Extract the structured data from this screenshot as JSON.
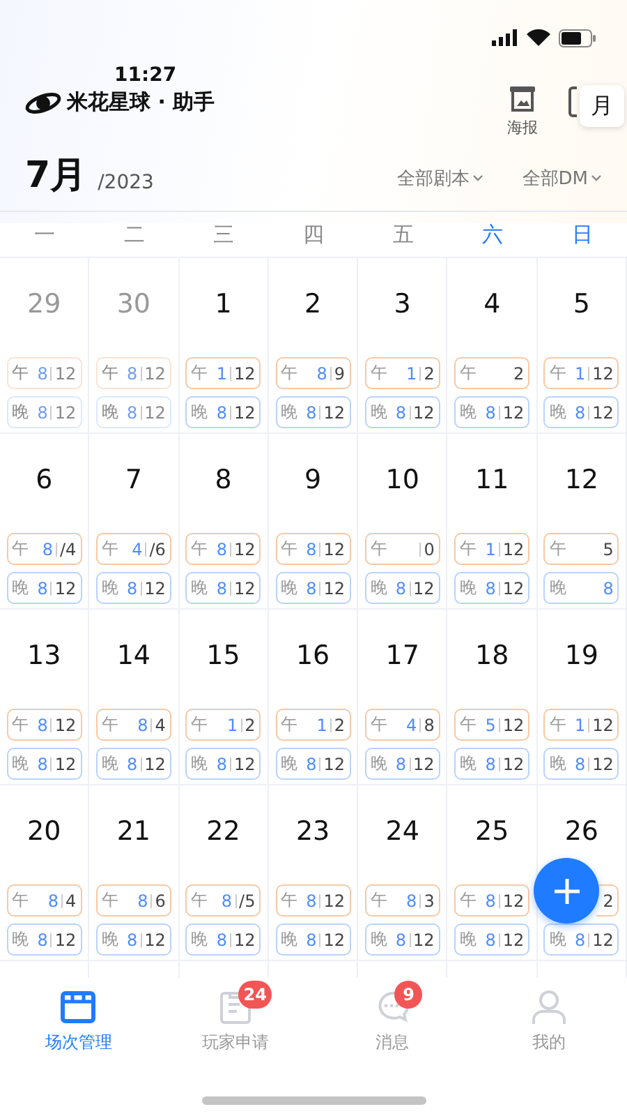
{
  "status_bar": {
    "time": "11:27"
  },
  "header": {
    "brand": "米花星球 · 助手",
    "actions": [
      {
        "label": "海报"
      }
    ],
    "view_toggle": "月"
  },
  "month_bar": {
    "month": "7月",
    "year": "/2023",
    "filters": [
      {
        "label": "全部剧本"
      },
      {
        "label": "全部DM"
      }
    ]
  },
  "weekdays": [
    {
      "label": "一",
      "weekend": false
    },
    {
      "label": "二",
      "weekend": false
    },
    {
      "label": "三",
      "weekend": false
    },
    {
      "label": "四",
      "weekend": false
    },
    {
      "label": "五",
      "weekend": false
    },
    {
      "label": "六",
      "weekend": true
    },
    {
      "label": "日",
      "weekend": true
    }
  ],
  "days": [
    {
      "day": "29",
      "faded": true,
      "slots": [
        {
          "kind": "noon",
          "label": "午",
          "booked": "8",
          "total": "12",
          "divider": true
        },
        {
          "kind": "evening",
          "label": "晚",
          "booked": "8",
          "total": "12",
          "divider": true
        }
      ]
    },
    {
      "day": "30",
      "faded": true,
      "slots": [
        {
          "kind": "noon",
          "label": "午",
          "booked": "8",
          "total": "12",
          "divider": true
        },
        {
          "kind": "evening",
          "label": "晚",
          "booked": "8",
          "total": "12",
          "divider": true
        }
      ]
    },
    {
      "day": "1",
      "faded": false,
      "slots": [
        {
          "kind": "noon",
          "label": "午",
          "booked": "1",
          "total": "12",
          "divider": true
        },
        {
          "kind": "evening",
          "label": "晚",
          "booked": "8",
          "total": "12",
          "divider": true
        }
      ]
    },
    {
      "day": "2",
      "faded": false,
      "slots": [
        {
          "kind": "noon",
          "label": "午",
          "booked": "8",
          "total": "9",
          "divider": true
        },
        {
          "kind": "evening",
          "label": "晚",
          "booked": "8",
          "total": "12",
          "divider": true
        }
      ]
    },
    {
      "day": "3",
      "faded": false,
      "slots": [
        {
          "kind": "noon",
          "label": "午",
          "booked": "1",
          "total": "2",
          "divider": true
        },
        {
          "kind": "evening",
          "label": "晚",
          "booked": "8",
          "total": "12",
          "divider": true
        }
      ]
    },
    {
      "day": "4",
      "faded": false,
      "slots": [
        {
          "kind": "noon",
          "label": "午",
          "total": "2",
          "divider": false
        },
        {
          "kind": "evening",
          "label": "晚",
          "booked": "8",
          "total": "12",
          "divider": true
        }
      ]
    },
    {
      "day": "5",
      "faded": false,
      "slots": [
        {
          "kind": "noon",
          "label": "午",
          "booked": "1",
          "total": "12",
          "divider": true
        },
        {
          "kind": "evening",
          "label": "晚",
          "booked": "8",
          "total": "12",
          "divider": true
        }
      ]
    },
    {
      "day": "6",
      "faded": false,
      "slots": [
        {
          "kind": "noon",
          "label": "午",
          "booked": "8",
          "total": "/4",
          "divider": true
        },
        {
          "kind": "evening",
          "label": "晚",
          "booked": "8",
          "total": "12",
          "divider": true
        }
      ]
    },
    {
      "day": "7",
      "faded": false,
      "slots": [
        {
          "kind": "noon",
          "label": "午",
          "booked": "4",
          "total": "/6",
          "divider": true
        },
        {
          "kind": "evening",
          "label": "晚",
          "booked": "8",
          "total": "12",
          "divider": true
        }
      ]
    },
    {
      "day": "8",
      "faded": false,
      "slots": [
        {
          "kind": "noon",
          "label": "午",
          "booked": "8",
          "total": "12",
          "divider": true
        },
        {
          "kind": "evening",
          "label": "晚",
          "booked": "8",
          "total": "12",
          "divider": true
        }
      ]
    },
    {
      "day": "9",
      "faded": false,
      "slots": [
        {
          "kind": "noon",
          "label": "午",
          "booked": "8",
          "total": "12",
          "divider": true
        },
        {
          "kind": "evening",
          "label": "晚",
          "booked": "8",
          "total": "12",
          "divider": true
        }
      ]
    },
    {
      "day": "10",
      "faded": false,
      "slots": [
        {
          "kind": "noon",
          "label": "午",
          "total": "0",
          "divider": true
        },
        {
          "kind": "evening",
          "label": "晚",
          "booked": "8",
          "total": "12",
          "divider": true
        }
      ]
    },
    {
      "day": "11",
      "faded": false,
      "slots": [
        {
          "kind": "noon",
          "label": "午",
          "booked": "1",
          "total": "12",
          "divider": true
        },
        {
          "kind": "evening",
          "label": "晚",
          "booked": "8",
          "total": "12",
          "divider": true
        }
      ]
    },
    {
      "day": "12",
      "faded": false,
      "slots": [
        {
          "kind": "noon",
          "label": "午",
          "total": "5",
          "divider": false
        },
        {
          "kind": "evening",
          "label": "晚",
          "booked": "8",
          "divider": false
        }
      ]
    },
    {
      "day": "13",
      "faded": false,
      "slots": [
        {
          "kind": "noon",
          "label": "午",
          "booked": "8",
          "total": "12",
          "divider": true
        },
        {
          "kind": "evening",
          "label": "晚",
          "booked": "8",
          "total": "12",
          "divider": true
        }
      ]
    },
    {
      "day": "14",
      "faded": false,
      "slots": [
        {
          "kind": "noon",
          "label": "午",
          "booked": "8",
          "total": "4",
          "divider": true
        },
        {
          "kind": "evening",
          "label": "晚",
          "booked": "8",
          "total": "12",
          "divider": true
        }
      ]
    },
    {
      "day": "15",
      "faded": false,
      "slots": [
        {
          "kind": "noon",
          "label": "午",
          "booked": "1",
          "total": "2",
          "divider": true
        },
        {
          "kind": "evening",
          "label": "晚",
          "booked": "8",
          "total": "12",
          "divider": true
        }
      ]
    },
    {
      "day": "16",
      "faded": false,
      "slots": [
        {
          "kind": "noon",
          "label": "午",
          "booked": "1",
          "total": "2",
          "divider": true
        },
        {
          "kind": "evening",
          "label": "晚",
          "booked": "8",
          "total": "12",
          "divider": true
        }
      ]
    },
    {
      "day": "17",
      "faded": false,
      "slots": [
        {
          "kind": "noon",
          "label": "午",
          "booked": "4",
          "total": "8",
          "divider": true
        },
        {
          "kind": "evening",
          "label": "晚",
          "booked": "8",
          "total": "12",
          "divider": true
        }
      ]
    },
    {
      "day": "18",
      "faded": false,
      "slots": [
        {
          "kind": "noon",
          "label": "午",
          "booked": "5",
          "total": "12",
          "divider": true
        },
        {
          "kind": "evening",
          "label": "晚",
          "booked": "8",
          "total": "12",
          "divider": true
        }
      ]
    },
    {
      "day": "19",
      "faded": false,
      "slots": [
        {
          "kind": "noon",
          "label": "午",
          "booked": "1",
          "total": "12",
          "divider": true
        },
        {
          "kind": "evening",
          "label": "晚",
          "booked": "8",
          "total": "12",
          "divider": true
        }
      ]
    },
    {
      "day": "20",
      "faded": false,
      "slots": [
        {
          "kind": "noon",
          "label": "午",
          "booked": "8",
          "total": "4",
          "divider": true
        },
        {
          "kind": "evening",
          "label": "晚",
          "booked": "8",
          "total": "12",
          "divider": true
        }
      ]
    },
    {
      "day": "21",
      "faded": false,
      "slots": [
        {
          "kind": "noon",
          "label": "午",
          "booked": "8",
          "total": "6",
          "divider": true
        },
        {
          "kind": "evening",
          "label": "晚",
          "booked": "8",
          "total": "12",
          "divider": true
        }
      ]
    },
    {
      "day": "22",
      "faded": false,
      "slots": [
        {
          "kind": "noon",
          "label": "午",
          "booked": "8",
          "total": "/5",
          "divider": true
        },
        {
          "kind": "evening",
          "label": "晚",
          "booked": "8",
          "total": "12",
          "divider": true
        }
      ]
    },
    {
      "day": "23",
      "faded": false,
      "slots": [
        {
          "kind": "noon",
          "label": "午",
          "booked": "8",
          "total": "12",
          "divider": true
        },
        {
          "kind": "evening",
          "label": "晚",
          "booked": "8",
          "total": "12",
          "divider": true
        }
      ]
    },
    {
      "day": "24",
      "faded": false,
      "slots": [
        {
          "kind": "noon",
          "label": "午",
          "booked": "8",
          "total": "3",
          "divider": true
        },
        {
          "kind": "evening",
          "label": "晚",
          "booked": "8",
          "total": "12",
          "divider": true
        }
      ]
    },
    {
      "day": "25",
      "faded": false,
      "slots": [
        {
          "kind": "noon",
          "label": "午",
          "booked": "8",
          "total": "12",
          "divider": true
        },
        {
          "kind": "evening",
          "label": "晚",
          "booked": "8",
          "total": "12",
          "divider": true
        }
      ]
    },
    {
      "day": "26",
      "faded": false,
      "slots": [
        {
          "kind": "noon",
          "total": "2",
          "divider": false
        },
        {
          "kind": "evening",
          "label": "晚",
          "booked": "8",
          "total": "12",
          "divider": true
        }
      ]
    }
  ],
  "tab_bar": [
    {
      "kind": "calendar",
      "label": "场次管理",
      "selected": true
    },
    {
      "kind": "clipboard",
      "label": "玩家申请",
      "selected": false,
      "badge": "24"
    },
    {
      "kind": "chat",
      "label": "消息",
      "selected": false,
      "badge": "9"
    },
    {
      "kind": "person",
      "label": "我的",
      "selected": false
    }
  ]
}
